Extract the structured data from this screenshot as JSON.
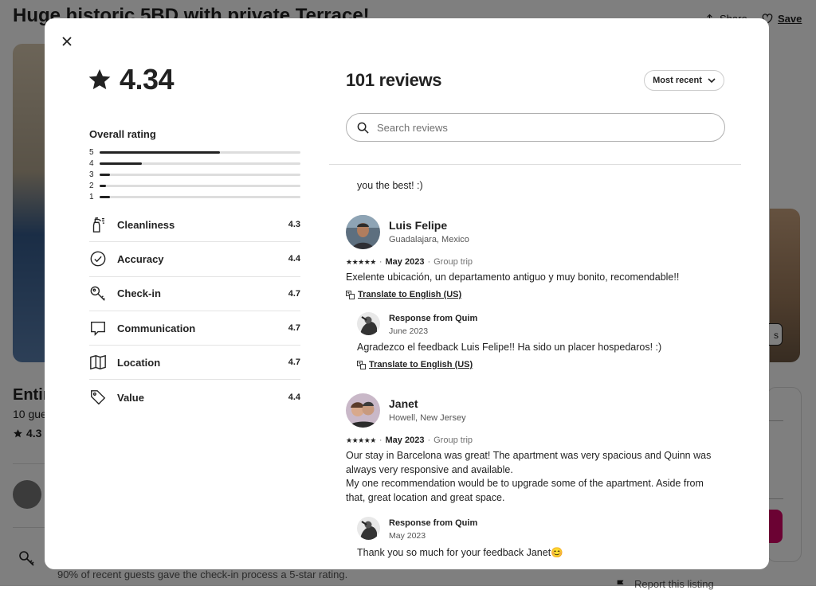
{
  "background": {
    "listing_title": "Huge historic 5BD with private Terrace!",
    "share_label": "Share",
    "save_label": "Save",
    "show_photos_label": "s",
    "entire_heading": "Entir",
    "guests_text": "10 gue",
    "rating_text": "4.3",
    "checkin_highlight": "90% of recent guests gave the check-in process a 5-star rating.",
    "report_label": "Report this listing"
  },
  "modal": {
    "overall_score": "4.34",
    "overall_label": "Overall rating",
    "distribution": [
      {
        "stars": "5",
        "fraction": 0.6
      },
      {
        "stars": "4",
        "fraction": 0.21
      },
      {
        "stars": "3",
        "fraction": 0.05
      },
      {
        "stars": "2",
        "fraction": 0.03
      },
      {
        "stars": "1",
        "fraction": 0.05
      }
    ],
    "categories": [
      {
        "name": "Cleanliness",
        "score": "4.3",
        "icon": "spray-bottle-icon"
      },
      {
        "name": "Accuracy",
        "score": "4.4",
        "icon": "check-circle-icon"
      },
      {
        "name": "Check-in",
        "score": "4.7",
        "icon": "key-icon"
      },
      {
        "name": "Communication",
        "score": "4.7",
        "icon": "chat-bubble-icon"
      },
      {
        "name": "Location",
        "score": "4.7",
        "icon": "map-icon"
      },
      {
        "name": "Value",
        "score": "4.4",
        "icon": "tag-icon"
      }
    ],
    "reviews_count_label": "101 reviews",
    "sort_label": "Most recent",
    "search_placeholder": "Search reviews",
    "prev_fragment": "you the best! :)",
    "reviews": [
      {
        "name": "Luis Felipe",
        "location": "Guadalajara, Mexico",
        "stars": "★★★★★",
        "date": "May 2023",
        "trip_type": "Group trip",
        "text": "Exelente ubicación, un departamento antiguo y muy bonito, recomendable!!",
        "translate_label": "Translate to English (US)",
        "response": {
          "from": "Response from Quim",
          "date": "June 2023",
          "text": "Agradezco el feedback Luis Felipe!! Ha sido un placer hospedaros! :)",
          "translate_label": "Translate to English (US)"
        }
      },
      {
        "name": "Janet",
        "location": "Howell, New Jersey",
        "stars": "★★★★★",
        "date": "May 2023",
        "trip_type": "Group trip",
        "text_lines": [
          "Our stay in Barcelona was great! The apartment was very spacious and Quinn was",
          "always very responsive and available.",
          "My one recommendation would be to upgrade some of the apartment. Aside from",
          "that, great location and great space."
        ],
        "response": {
          "from": "Response from Quim",
          "date": "May 2023",
          "text": "Thank you so much for your feedback Janet😊"
        }
      }
    ],
    "meta_separator": "·"
  }
}
